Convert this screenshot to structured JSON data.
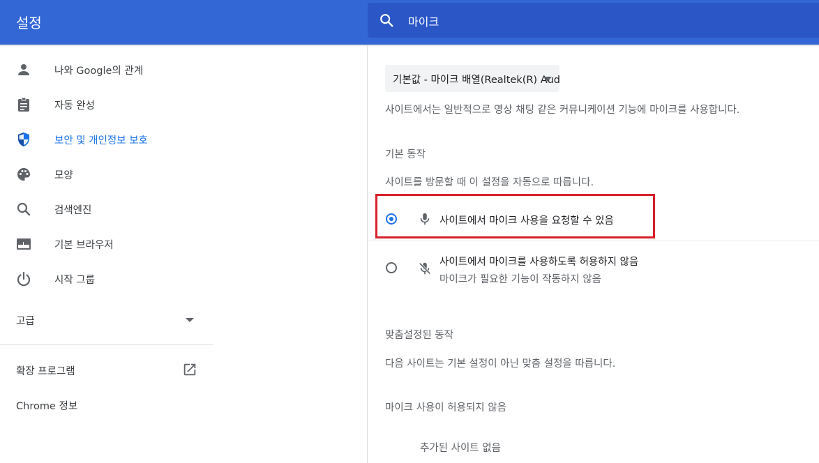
{
  "header": {
    "title": "설정",
    "search_value": "마이크"
  },
  "sidebar": {
    "items": [
      {
        "label": "나와 Google의 관계",
        "icon": "person-icon"
      },
      {
        "label": "자동 완성",
        "icon": "clipboard-icon"
      },
      {
        "label": "보안 및 개인정보 보호",
        "icon": "shield-icon",
        "active": true
      },
      {
        "label": "모양",
        "icon": "palette-icon"
      },
      {
        "label": "검색엔진",
        "icon": "search-icon"
      },
      {
        "label": "기본 브라우저",
        "icon": "browser-icon"
      },
      {
        "label": "시작 그룹",
        "icon": "power-icon"
      }
    ],
    "advanced_label": "고급",
    "extensions_label": "확장 프로그램",
    "about_label": "Chrome 정보"
  },
  "main": {
    "device_select": "기본값 - 마이크 배열(Realtek(R) Audio)",
    "description": "사이트에서는 일반적으로 영상 채팅 같은 커뮤니케이션 기능에 마이크를 사용합니다.",
    "default_behavior": {
      "heading": "기본 동작",
      "subtext": "사이트를 방문할 때 이 설정을 자동으로 따릅니다.",
      "options": [
        {
          "label": "사이트에서 마이크 사용을 요청할 수 있음",
          "selected": true,
          "icon": "mic-icon"
        },
        {
          "label": "사이트에서 마이크를 사용하도록 허용하지 않음",
          "sub": "마이크가 필요한 기능이 작동하지 않음",
          "selected": false,
          "icon": "mic-off-icon"
        }
      ]
    },
    "custom_behavior": {
      "heading": "맞춤설정된 동작",
      "subtext": "다음 사이트는 기본 설정이 아닌 맞춤 설정을 따릅니다.",
      "blocked_heading": "마이크 사용이 허용되지 않음",
      "empty_text": "추가된 사이트 없음"
    }
  },
  "colors": {
    "header_bg": "#3367d6",
    "search_bg": "#2a56c6",
    "accent": "#1a73e8",
    "highlight_border": "#d81f2a"
  }
}
